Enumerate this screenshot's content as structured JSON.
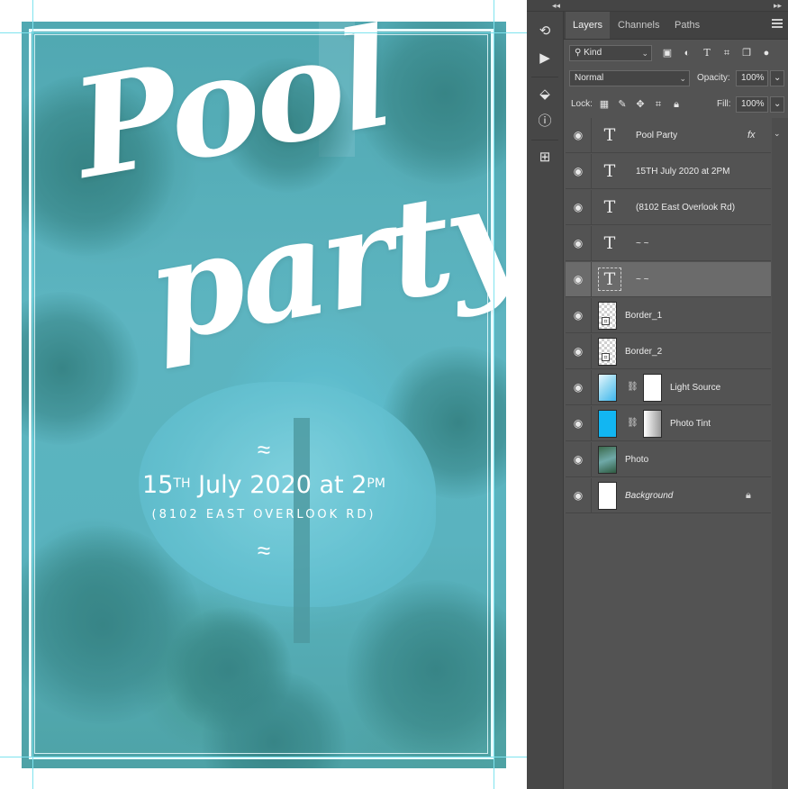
{
  "poster": {
    "title_line1": "Pool",
    "title_line2": "party",
    "wave_top": "≈",
    "date_day": "15",
    "date_day_sup": "TH",
    "date_middle": " July 2020 at 2",
    "date_time_sup": "PM",
    "address": "(8102 EAST OVERLOOK RD)",
    "wave_bottom": "≈"
  },
  "colors": {
    "poster_tint": "#56bace",
    "guide": "#7fe3ee",
    "panel_bg": "#535353",
    "selected_layer": "#6b6b6b"
  },
  "panel": {
    "collapse_left": "◂◂",
    "collapse_right": "▸▸",
    "tabs": [
      {
        "label": "Layers",
        "active": true
      },
      {
        "label": "Channels",
        "active": false
      },
      {
        "label": "Paths",
        "active": false
      }
    ],
    "filter": {
      "kind_label": "Kind",
      "icons": [
        "image-filter-icon",
        "adjustment-filter-icon",
        "type-filter-icon",
        "shape-filter-icon",
        "smart-object-filter-icon"
      ]
    },
    "blend_mode": "Normal",
    "opacity_label": "Opacity:",
    "opacity_value": "100%",
    "lock_label": "Lock:",
    "fill_label": "Fill:",
    "fill_value": "100%",
    "layers": [
      {
        "name": "Pool  Party",
        "kind": "type",
        "fx": "fx",
        "selected": false
      },
      {
        "name": "15TH July 2020 at 2PM",
        "kind": "type",
        "selected": false
      },
      {
        "name": "(8102 East Overlook Rd)",
        "kind": "type",
        "selected": false
      },
      {
        "name": "~ ~",
        "kind": "type",
        "selected": false
      },
      {
        "name": "~ ~",
        "kind": "type",
        "selected": true
      },
      {
        "name": "Border_1",
        "kind": "shape",
        "selected": false
      },
      {
        "name": "Border_2",
        "kind": "shape",
        "selected": false
      },
      {
        "name": "Light Source",
        "kind": "fill-mask",
        "selected": false
      },
      {
        "name": "Photo Tint",
        "kind": "fill-mask",
        "selected": false
      },
      {
        "name": "Photo",
        "kind": "photo",
        "selected": false
      },
      {
        "name": "Background",
        "kind": "background",
        "selected": false
      }
    ]
  }
}
